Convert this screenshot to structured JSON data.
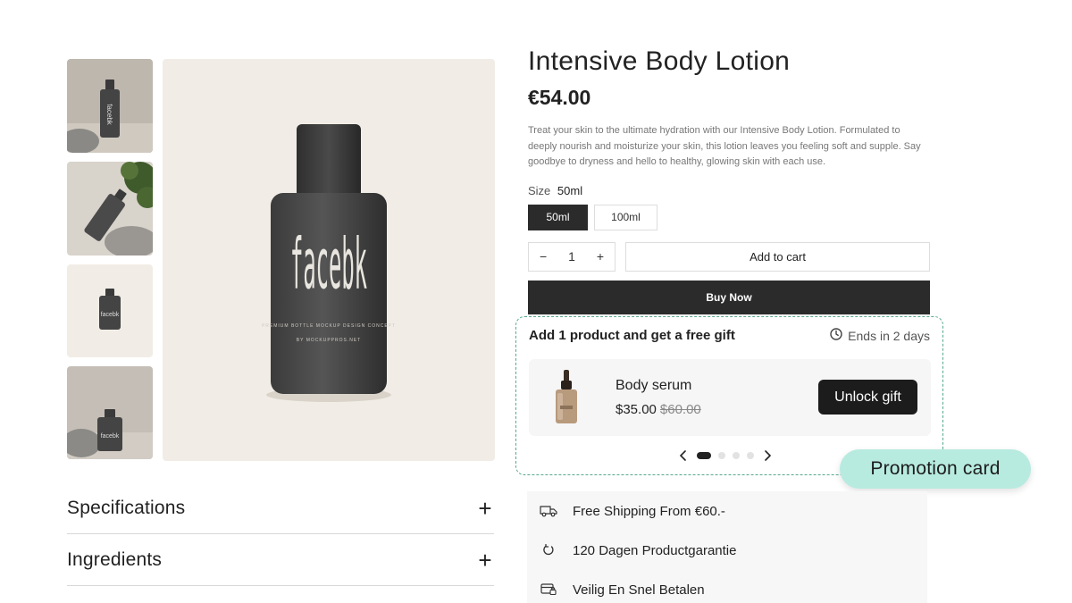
{
  "product": {
    "title": "Intensive Body Lotion",
    "price": "€54.00",
    "description": "Treat your skin to the ultimate hydration with our Intensive Body Lotion. Formulated to deeply nourish and moisturize your skin, this lotion leaves you feeling soft and supple. Say goodbye to dryness and hello to healthy, glowing skin with each use.",
    "bottle_brand": "facebk",
    "bottle_line1": "PREMIUM BOTTLE MOCKUP DESIGN CONCEPT",
    "bottle_line2": "BY MOCKUPPROS.NET"
  },
  "size": {
    "label": "Size",
    "selected": "50ml",
    "options": [
      "50ml",
      "100ml"
    ]
  },
  "cart": {
    "minus": "−",
    "quantity": "1",
    "plus": "+",
    "add_to_cart": "Add to cart",
    "buy_now": "Buy Now"
  },
  "promotion": {
    "title": "Add 1 product and get a free gift",
    "ends": "Ends in 2 days",
    "item_name": "Body serum",
    "item_price": "$35.00",
    "item_old_price": "$60.00",
    "unlock_button": "Unlock gift",
    "slides": 4,
    "active_slide": 1,
    "callout": "Promotion card"
  },
  "accordion": {
    "items": [
      "Specifications",
      "Ingredients"
    ],
    "toggle": "+"
  },
  "benefits": [
    {
      "icon": "truck-icon",
      "text": "Free Shipping From €60.-"
    },
    {
      "icon": "refresh-icon",
      "text": "120 Dagen Productgarantie"
    },
    {
      "icon": "secure-payment-icon",
      "text": "Veilig En Snel Betalen"
    }
  ],
  "colors": {
    "dark_button": "#2b2b2b",
    "promo_border": "#58a98d",
    "callout_bg": "#b8ebe0",
    "image_bg": "#f1ede6"
  }
}
